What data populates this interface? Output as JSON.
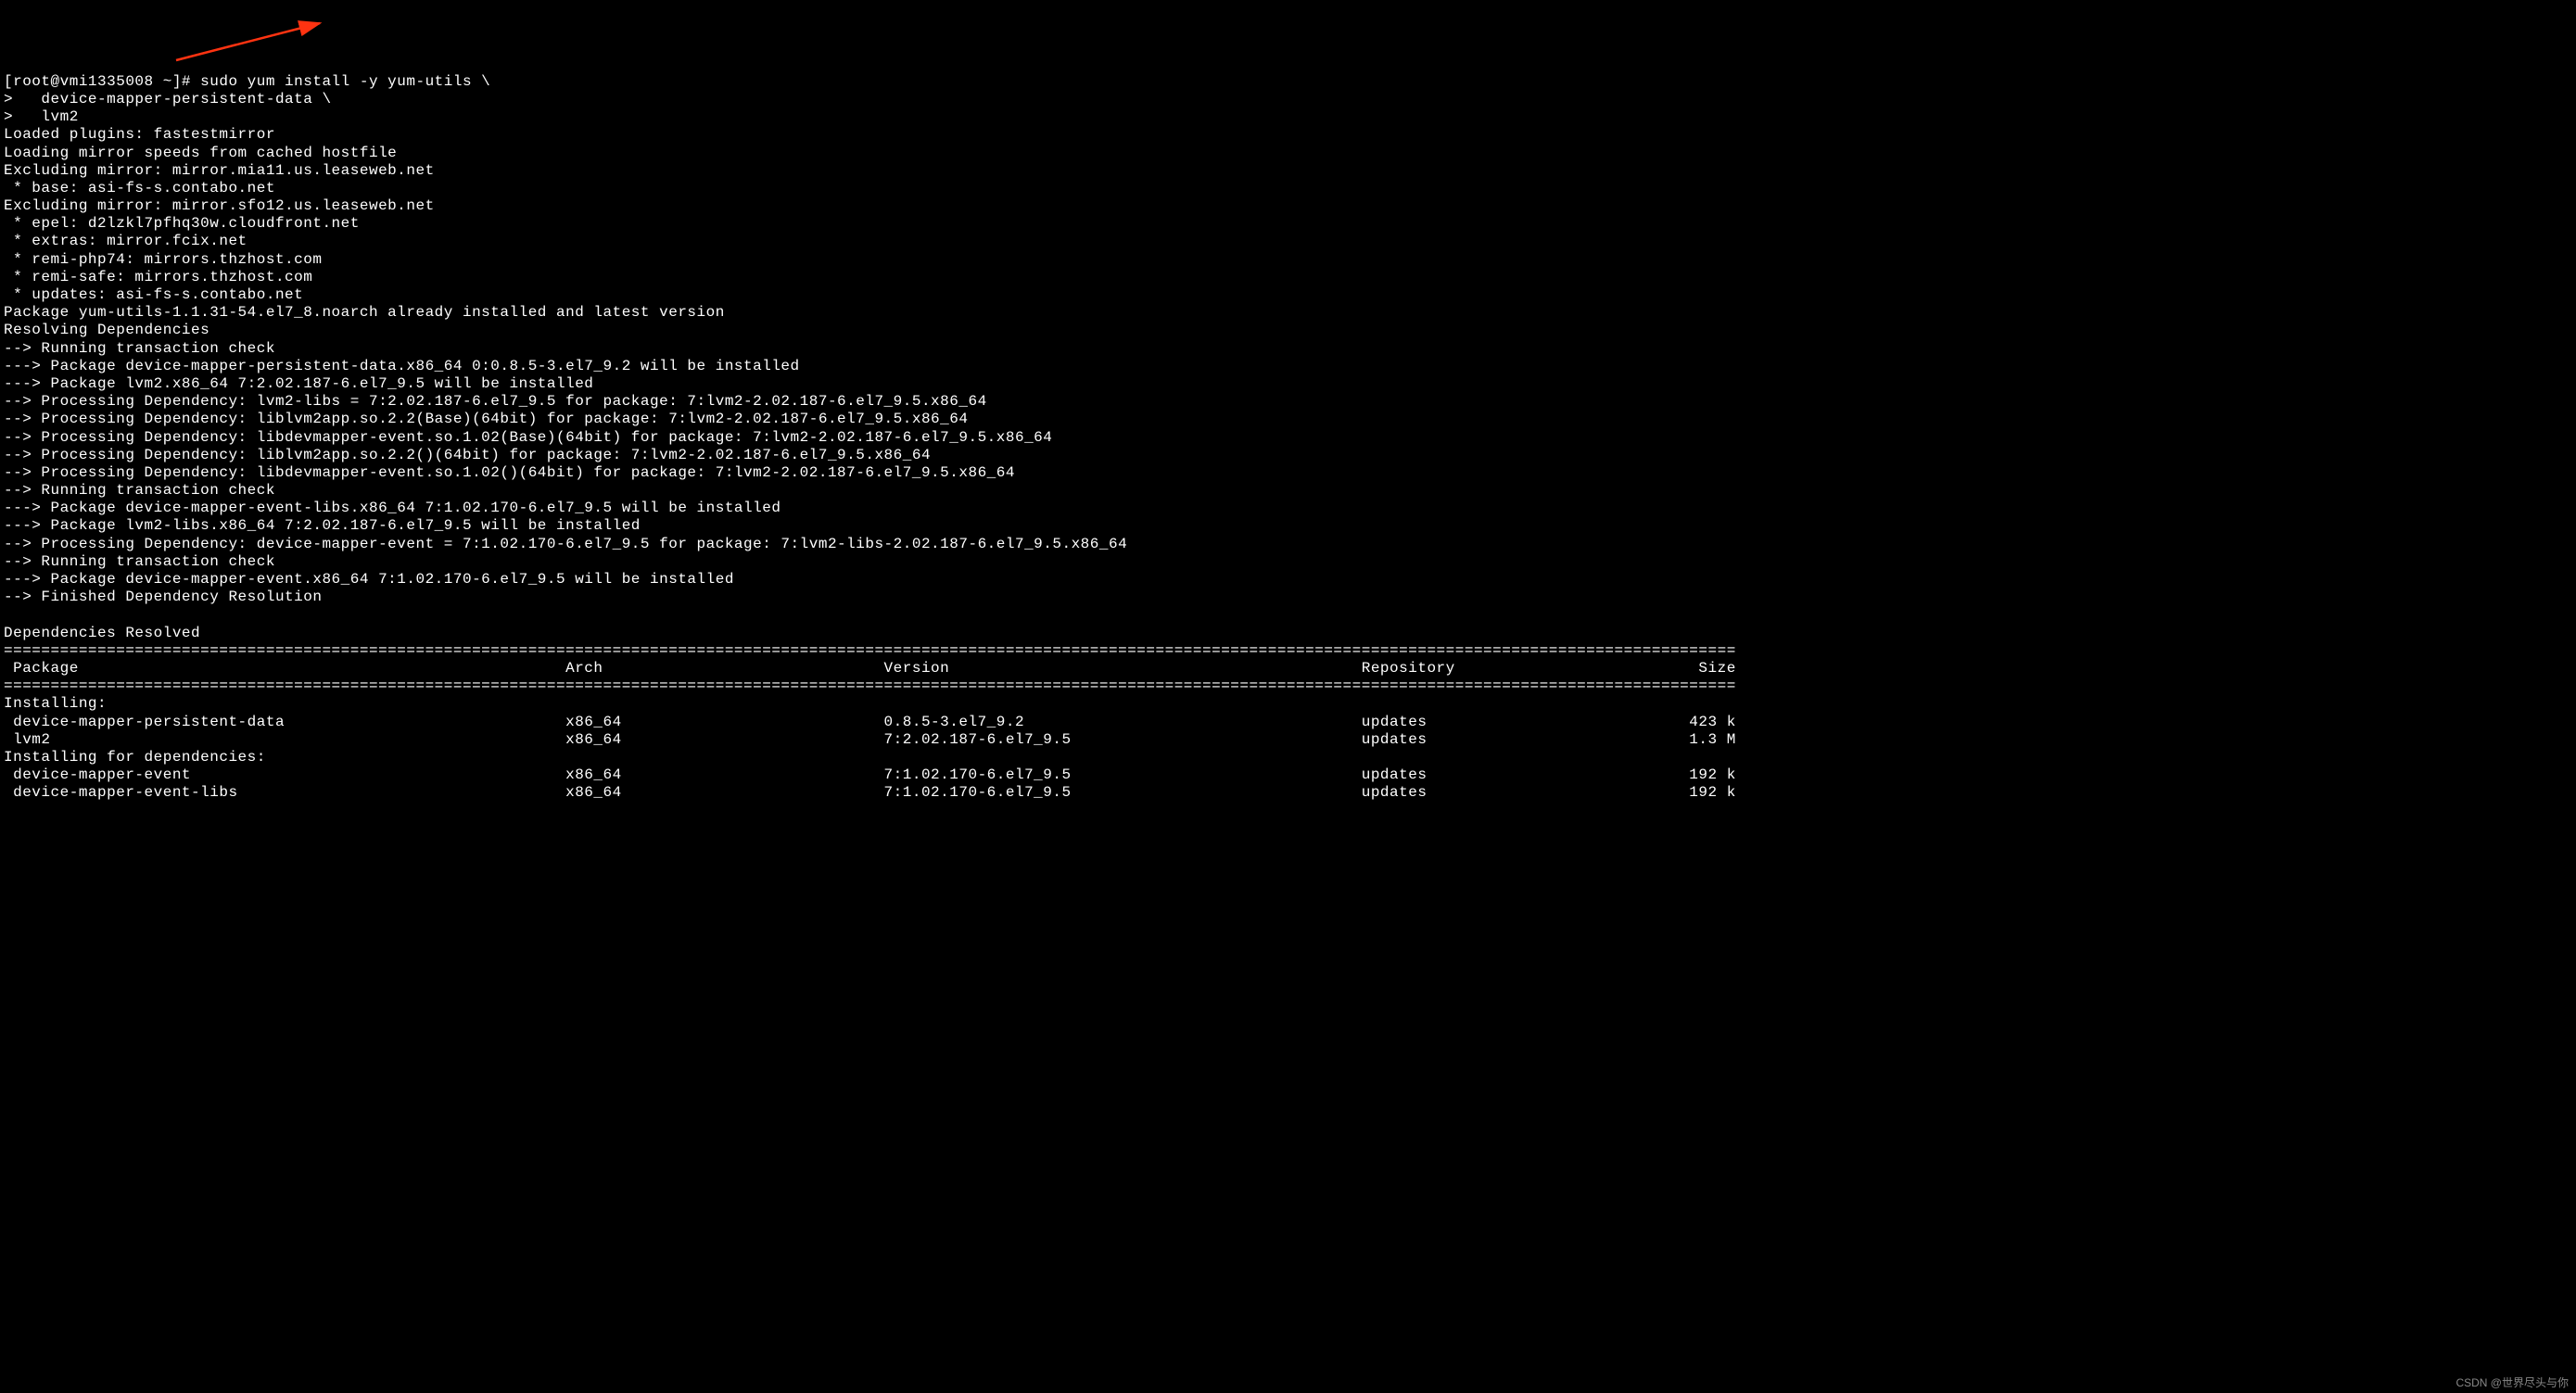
{
  "prompt": {
    "line1": "[root@vmi1335008 ~]# sudo yum install -y yum-utils \\",
    "line2": ">   device-mapper-persistent-data \\",
    "line3": ">   lvm2"
  },
  "output_lines": [
    "Loaded plugins: fastestmirror",
    "Loading mirror speeds from cached hostfile",
    "Excluding mirror: mirror.mia11.us.leaseweb.net",
    " * base: asi-fs-s.contabo.net",
    "Excluding mirror: mirror.sfo12.us.leaseweb.net",
    " * epel: d2lzkl7pfhq30w.cloudfront.net",
    " * extras: mirror.fcix.net",
    " * remi-php74: mirrors.thzhost.com",
    " * remi-safe: mirrors.thzhost.com",
    " * updates: asi-fs-s.contabo.net",
    "Package yum-utils-1.1.31-54.el7_8.noarch already installed and latest version",
    "Resolving Dependencies",
    "--> Running transaction check",
    "---> Package device-mapper-persistent-data.x86_64 0:0.8.5-3.el7_9.2 will be installed",
    "---> Package lvm2.x86_64 7:2.02.187-6.el7_9.5 will be installed",
    "--> Processing Dependency: lvm2-libs = 7:2.02.187-6.el7_9.5 for package: 7:lvm2-2.02.187-6.el7_9.5.x86_64",
    "--> Processing Dependency: liblvm2app.so.2.2(Base)(64bit) for package: 7:lvm2-2.02.187-6.el7_9.5.x86_64",
    "--> Processing Dependency: libdevmapper-event.so.1.02(Base)(64bit) for package: 7:lvm2-2.02.187-6.el7_9.5.x86_64",
    "--> Processing Dependency: liblvm2app.so.2.2()(64bit) for package: 7:lvm2-2.02.187-6.el7_9.5.x86_64",
    "--> Processing Dependency: libdevmapper-event.so.1.02()(64bit) for package: 7:lvm2-2.02.187-6.el7_9.5.x86_64",
    "--> Running transaction check",
    "---> Package device-mapper-event-libs.x86_64 7:1.02.170-6.el7_9.5 will be installed",
    "---> Package lvm2-libs.x86_64 7:2.02.187-6.el7_9.5 will be installed",
    "--> Processing Dependency: device-mapper-event = 7:1.02.170-6.el7_9.5 for package: 7:lvm2-libs-2.02.187-6.el7_9.5.x86_64",
    "--> Running transaction check",
    "---> Package device-mapper-event.x86_64 7:1.02.170-6.el7_9.5 will be installed",
    "--> Finished Dependency Resolution",
    "",
    "Dependencies Resolved",
    ""
  ],
  "table": {
    "separator_width": 185,
    "headers": {
      "package": " Package",
      "arch": "Arch",
      "version": "Version",
      "repository": "Repository",
      "size": "Size"
    },
    "sections": [
      {
        "title": "Installing:",
        "rows": [
          {
            "package": " device-mapper-persistent-data",
            "arch": "x86_64",
            "version": "0.8.5-3.el7_9.2",
            "repository": "updates",
            "size": "423 k"
          },
          {
            "package": " lvm2",
            "arch": "x86_64",
            "version": "7:2.02.187-6.el7_9.5",
            "repository": "updates",
            "size": "1.3 M"
          }
        ]
      },
      {
        "title": "Installing for dependencies:",
        "rows": [
          {
            "package": " device-mapper-event",
            "arch": "x86_64",
            "version": "7:1.02.170-6.el7_9.5",
            "repository": "updates",
            "size": "192 k"
          },
          {
            "package": " device-mapper-event-libs",
            "arch": "x86_64",
            "version": "7:1.02.170-6.el7_9.5",
            "repository": "updates",
            "size": "192 k"
          }
        ]
      }
    ]
  },
  "watermark": "CSDN @世界尽头与你"
}
